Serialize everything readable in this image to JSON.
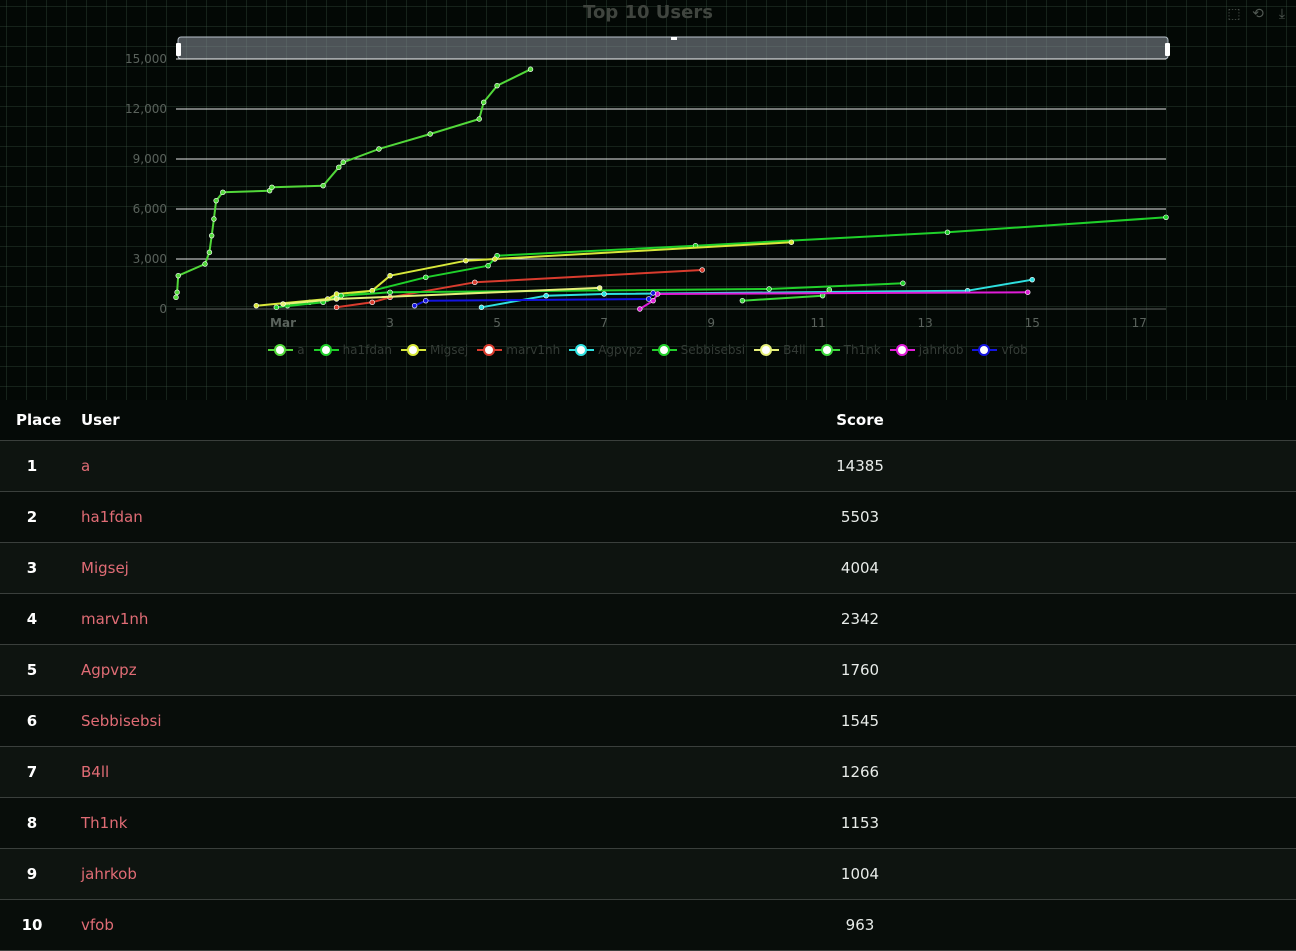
{
  "chart_data": {
    "type": "line",
    "title": "Top 10 Users",
    "x_axis": {
      "type": "time",
      "range": [
        "2025-02-27",
        "2025-03-17 12:00"
      ],
      "tick_labels": [
        "Mar",
        "3",
        "5",
        "7",
        "9",
        "11",
        "13",
        "15",
        "17"
      ],
      "tick_dates": [
        "2025-03-01",
        "2025-03-03",
        "2025-03-05",
        "2025-03-07",
        "2025-03-09",
        "2025-03-11",
        "2025-03-13",
        "2025-03-15",
        "2025-03-17"
      ]
    },
    "y_axis": {
      "range": [
        0,
        15000
      ],
      "tick_labels": [
        "0",
        "3,000",
        "6,000",
        "9,000",
        "12,000",
        "15,000"
      ],
      "ticks": [
        0,
        3000,
        6000,
        9000,
        12000,
        15000
      ]
    },
    "grid": true,
    "legend_position": "bottom",
    "data_zoom": "top slider",
    "series": [
      {
        "name": "a",
        "color": "#52d83a",
        "points": [
          [
            "2025-02-27 00:00",
            700
          ],
          [
            "2025-02-27 00:30",
            1000
          ],
          [
            "2025-02-27 01:00",
            2000
          ],
          [
            "2025-02-27 13:00",
            2700
          ],
          [
            "2025-02-27 15:00",
            3400
          ],
          [
            "2025-02-27 16:00",
            4400
          ],
          [
            "2025-02-27 17:00",
            5400
          ],
          [
            "2025-02-27 18:00",
            6500
          ],
          [
            "2025-02-27 21:00",
            7000
          ],
          [
            "2025-02-28 18:00",
            7100
          ],
          [
            "2025-02-28 19:00",
            7300
          ],
          [
            "2025-03-01 18:00",
            7400
          ],
          [
            "2025-03-02 01:00",
            8500
          ],
          [
            "2025-03-02 03:00",
            8800
          ],
          [
            "2025-03-02 19:00",
            9600
          ],
          [
            "2025-03-03 18:00",
            10500
          ],
          [
            "2025-03-04 16:00",
            11400
          ],
          [
            "2025-03-04 18:00",
            12400
          ],
          [
            "2025-03-05 00:00",
            13400
          ],
          [
            "2025-03-05 15:00",
            14385
          ]
        ]
      },
      {
        "name": "ha1fdan",
        "color": "#1fd02a",
        "points": [
          [
            "2025-03-01 02:00",
            200
          ],
          [
            "2025-03-01 12:00",
            400
          ],
          [
            "2025-03-02 00:00",
            700
          ],
          [
            "2025-03-02 16:00",
            1100
          ],
          [
            "2025-03-03 16:00",
            1900
          ],
          [
            "2025-03-04 20:00",
            2600
          ],
          [
            "2025-03-05 00:00",
            3200
          ],
          [
            "2025-03-08 17:00",
            3800
          ],
          [
            "2025-03-13 10:00",
            4600
          ],
          [
            "2025-03-17 12:00",
            5503
          ]
        ]
      },
      {
        "name": "Migsej",
        "color": "#d8e83a",
        "points": [
          [
            "2025-02-28 12:00",
            200
          ],
          [
            "2025-03-01 20:00",
            600
          ],
          [
            "2025-03-02 00:00",
            900
          ],
          [
            "2025-03-02 16:00",
            1100
          ],
          [
            "2025-03-03 00:00",
            2000
          ],
          [
            "2025-03-04 10:00",
            2900
          ],
          [
            "2025-03-04 23:00",
            3000
          ],
          [
            "2025-03-10 12:00",
            4004
          ]
        ]
      },
      {
        "name": "marv1nh",
        "color": "#d93c2e",
        "points": [
          [
            "2025-03-02 00:00",
            100
          ],
          [
            "2025-03-02 16:00",
            400
          ],
          [
            "2025-03-03 00:00",
            700
          ],
          [
            "2025-03-04 14:00",
            1600
          ],
          [
            "2025-03-08 20:00",
            2342
          ]
        ]
      },
      {
        "name": "Agpvpz",
        "color": "#2ee0e0",
        "points": [
          [
            "2025-03-04 17:00",
            100
          ],
          [
            "2025-03-05 22:00",
            800
          ],
          [
            "2025-03-07 00:00",
            900
          ],
          [
            "2025-03-13 19:00",
            1100
          ],
          [
            "2025-03-15 00:00",
            1760
          ]
        ]
      },
      {
        "name": "Sebbisebsi",
        "color": "#22d02c",
        "points": [
          [
            "2025-02-28 21:00",
            100
          ],
          [
            "2025-03-01 18:00",
            400
          ],
          [
            "2025-03-02 02:00",
            800
          ],
          [
            "2025-03-03 00:00",
            1000
          ],
          [
            "2025-03-10 02:00",
            1200
          ],
          [
            "2025-03-12 14:00",
            1545
          ]
        ]
      },
      {
        "name": "B4ll",
        "color": "#e6f07a",
        "points": [
          [
            "2025-03-01 00:00",
            300
          ],
          [
            "2025-03-02 00:00",
            600
          ],
          [
            "2025-03-06 22:00",
            1266
          ]
        ]
      },
      {
        "name": "Th1nk",
        "color": "#3cd83c",
        "points": [
          [
            "2025-03-09 14:00",
            500
          ],
          [
            "2025-03-11 02:00",
            800
          ],
          [
            "2025-03-11 05:00",
            1153
          ]
        ]
      },
      {
        "name": "jahrkob",
        "color": "#e01cd8",
        "points": [
          [
            "2025-03-07 16:00",
            0
          ],
          [
            "2025-03-07 22:00",
            500
          ],
          [
            "2025-03-08 00:00",
            900
          ],
          [
            "2025-03-14 22:00",
            1004
          ]
        ]
      },
      {
        "name": "vfob",
        "color": "#1414e0",
        "points": [
          [
            "2025-03-03 11:00",
            200
          ],
          [
            "2025-03-03 16:00",
            500
          ],
          [
            "2025-03-07 20:00",
            600
          ],
          [
            "2025-03-07 22:00",
            963
          ]
        ]
      }
    ]
  },
  "toolbox": {
    "icons": [
      "zoom-in-icon",
      "zoom-reset-icon",
      "download-icon"
    ]
  },
  "table": {
    "headers": {
      "place": "Place",
      "user": "User",
      "score": "Score"
    },
    "rows": [
      {
        "place": "1",
        "user": "a",
        "score": "14385"
      },
      {
        "place": "2",
        "user": "ha1fdan",
        "score": "5503"
      },
      {
        "place": "3",
        "user": "Migsej",
        "score": "4004"
      },
      {
        "place": "4",
        "user": "marv1nh",
        "score": "2342"
      },
      {
        "place": "5",
        "user": "Agpvpz",
        "score": "1760"
      },
      {
        "place": "6",
        "user": "Sebbisebsi",
        "score": "1545"
      },
      {
        "place": "7",
        "user": "B4ll",
        "score": "1266"
      },
      {
        "place": "8",
        "user": "Th1nk",
        "score": "1153"
      },
      {
        "place": "9",
        "user": "jahrkob",
        "score": "1004"
      },
      {
        "place": "10",
        "user": "vfob",
        "score": "963"
      }
    ],
    "user_link_color": "#e06c75"
  }
}
